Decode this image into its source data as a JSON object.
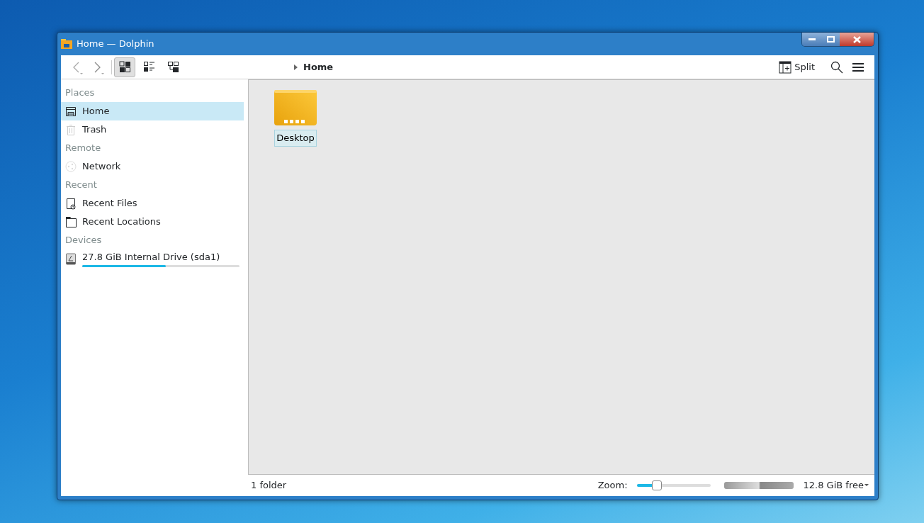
{
  "window": {
    "title": "Home — Dolphin"
  },
  "toolbar": {
    "view_modes": [
      {
        "kind": "icons",
        "selected": true
      },
      {
        "kind": "details",
        "selected": false
      },
      {
        "kind": "tree",
        "selected": false
      }
    ],
    "breadcrumb": "Home",
    "split": "Split"
  },
  "sidebar": {
    "sections": [
      {
        "heading": "Places",
        "items": [
          {
            "kind": "home",
            "label": "Home",
            "selected": true
          },
          {
            "kind": "trash",
            "label": "Trash",
            "selected": false
          }
        ]
      },
      {
        "heading": "Remote",
        "items": [
          {
            "kind": "network",
            "label": "Network",
            "selected": false
          }
        ]
      },
      {
        "heading": "Recent",
        "items": [
          {
            "kind": "recent-files",
            "label": "Recent Files",
            "selected": false
          },
          {
            "kind": "recent-locations",
            "label": "Recent Locations",
            "selected": false
          }
        ]
      },
      {
        "heading": "Devices",
        "items": [
          {
            "kind": "drive",
            "label": "27.8 GiB Internal Drive (sda1)",
            "selected": false,
            "level": 0.53
          }
        ]
      }
    ]
  },
  "files": [
    {
      "name": "Desktop",
      "selected": true
    }
  ],
  "status_bar": {
    "count": "1 folder",
    "zoom_label": "Zoom:",
    "zoom": {
      "level": 0.27
    },
    "free": "12.8 GiB free"
  }
}
